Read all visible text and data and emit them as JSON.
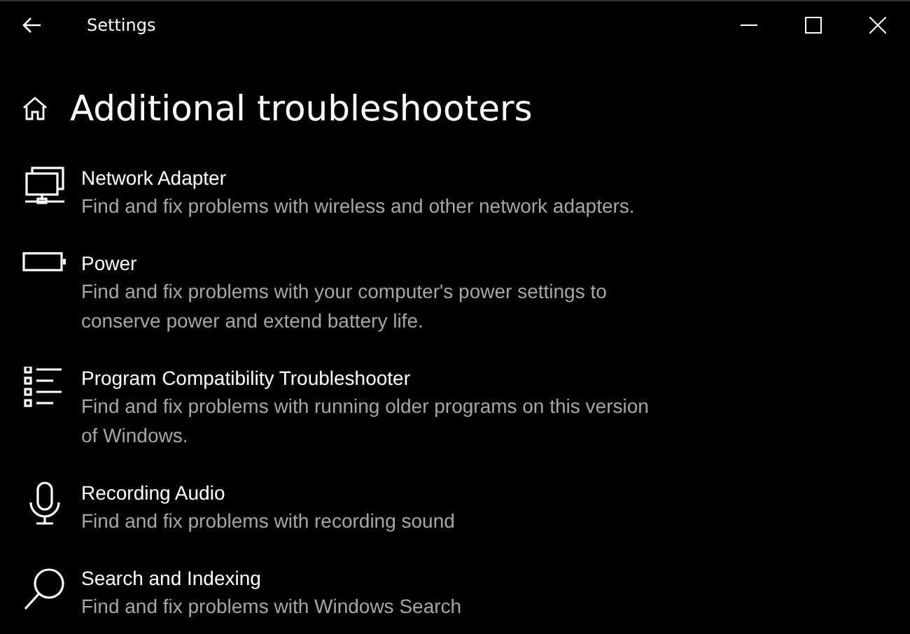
{
  "window": {
    "title": "Settings"
  },
  "page": {
    "title": "Additional troubleshooters"
  },
  "items": [
    {
      "kind": "network",
      "title": "Network Adapter",
      "description": "Find and fix problems with wireless and other network adapters."
    },
    {
      "kind": "battery",
      "title": "Power",
      "description": "Find and fix problems with your computer's power settings to conserve power and extend battery life."
    },
    {
      "kind": "list",
      "title": "Program Compatibility Troubleshooter",
      "description": "Find and fix problems with running older programs on this version of Windows."
    },
    {
      "kind": "microphone",
      "title": "Recording Audio",
      "description": "Find and fix problems with recording sound"
    },
    {
      "kind": "search",
      "title": "Search and Indexing",
      "description": "Find and fix problems with Windows Search"
    }
  ]
}
